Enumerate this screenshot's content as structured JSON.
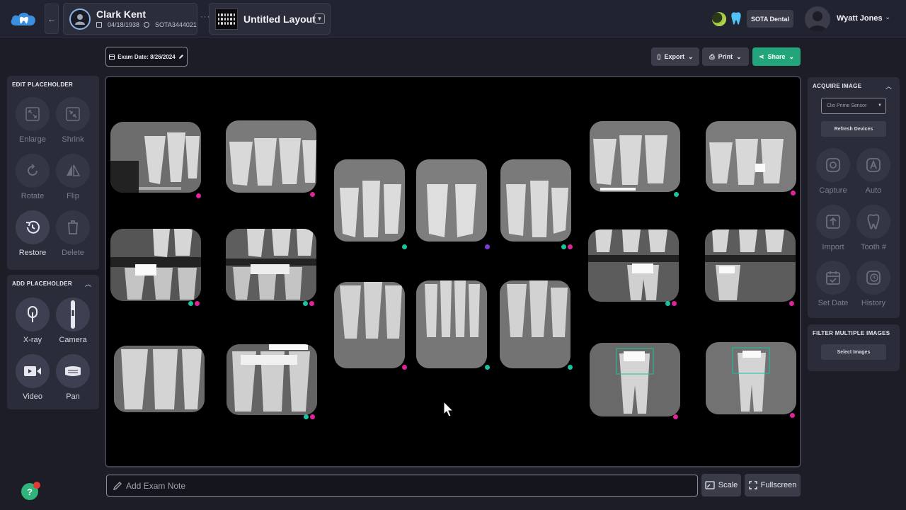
{
  "patient": {
    "name": "Clark Kent",
    "dob": "04/18/1938",
    "id": "SOTA3444021"
  },
  "layout": {
    "title": "Untitled Layout"
  },
  "header": {
    "practice": "SOTA Dental",
    "user": "Wyatt Jones"
  },
  "toolbar": {
    "exam_date": "Exam Date: 8/26/2024",
    "export": "Export",
    "print": "Print",
    "share": "Share"
  },
  "edit_placeholder": {
    "title": "EDIT PLACEHOLDER",
    "tools": [
      {
        "label": "Enlarge",
        "icon": "enlarge-icon"
      },
      {
        "label": "Shrink",
        "icon": "shrink-icon"
      },
      {
        "label": "Rotate",
        "icon": "rotate-icon"
      },
      {
        "label": "Flip",
        "icon": "flip-icon"
      },
      {
        "label": "Restore",
        "icon": "restore-icon"
      },
      {
        "label": "Delete",
        "icon": "trash-icon"
      }
    ]
  },
  "add_placeholder": {
    "title": "ADD PLACEHOLDER",
    "tools": [
      {
        "label": "X-ray",
        "icon": "xray-sensor-icon"
      },
      {
        "label": "Camera",
        "icon": "intraoral-camera-icon"
      },
      {
        "label": "Video",
        "icon": "video-icon"
      },
      {
        "label": "Pan",
        "icon": "panoramic-icon"
      }
    ]
  },
  "acquire_image": {
    "title": "ACQUIRE IMAGE",
    "device_placeholder": "Clio Prime Sensor",
    "refresh": "Refresh Devices",
    "tools": [
      {
        "label": "Capture",
        "icon": "capture-icon"
      },
      {
        "label": "Auto",
        "icon": "auto-icon"
      },
      {
        "label": "Import",
        "icon": "import-icon"
      },
      {
        "label": "Tooth #",
        "icon": "tooth-icon"
      },
      {
        "label": "Set Date",
        "icon": "calendar-icon"
      },
      {
        "label": "History",
        "icon": "history-icon"
      }
    ]
  },
  "filter_images": {
    "title": "FILTER MULTIPLE IMAGES",
    "button": "Select Images"
  },
  "footer": {
    "note_placeholder": "Add Exam Note",
    "scale": "Scale",
    "fullscreen": "Fullscreen"
  },
  "status_colors": {
    "magenta": "#e0239a",
    "teal": "#19c3a0",
    "purple": "#7d3bd8",
    "share_green": "#23a57b"
  }
}
